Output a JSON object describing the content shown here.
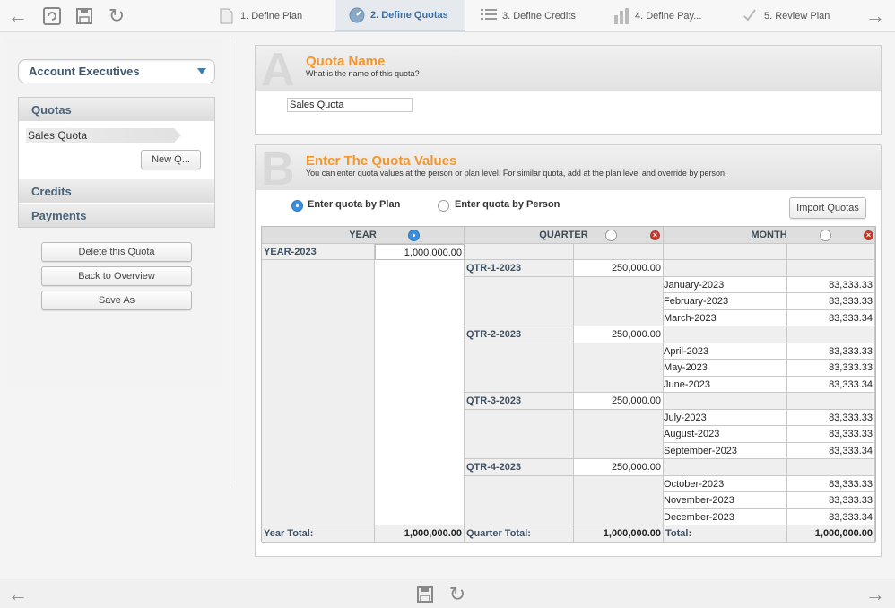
{
  "wizard": {
    "steps": [
      {
        "label": "1. Define Plan",
        "icon": "document-icon"
      },
      {
        "label": "2. Define Quotas",
        "icon": "gauge-icon"
      },
      {
        "label": "3. Define Credits",
        "icon": "list-icon"
      },
      {
        "label": "4. Define Pay...",
        "icon": "bar-chart-icon"
      },
      {
        "label": "5. Review Plan",
        "icon": "check-icon"
      }
    ]
  },
  "sidebar": {
    "role_select": "Account Executives",
    "quotas_label": "Quotas",
    "quota_item": "Sales Quota",
    "new_quota_button": "New Q...",
    "credits_label": "Credits",
    "payments_label": "Payments",
    "delete_button": "Delete this Quota",
    "back_button": "Back to Overview",
    "saveas_button": "Save As"
  },
  "section_a": {
    "letter": "A",
    "title": "Quota Name",
    "subtitle": "What is the name of this quota?",
    "name_value": "Sales Quota"
  },
  "section_b": {
    "letter": "B",
    "title": "Enter The Quota Values",
    "subtitle": "You can enter quota values at the person or plan level. For similar quota, add at the plan level and override by person.",
    "radio_plan": "Enter quota by Plan",
    "radio_person": "Enter quota by Person",
    "import_button": "Import Quotas"
  },
  "table": {
    "headers": {
      "year": "YEAR",
      "quarter": "QUARTER",
      "month": "MONTH"
    },
    "year": {
      "label": "YEAR-2023",
      "value": "1,000,000.00"
    },
    "quarters": [
      {
        "label": "QTR-1-2023",
        "value": "250,000.00",
        "months": [
          {
            "label": "January-2023",
            "value": "83,333.33"
          },
          {
            "label": "February-2023",
            "value": "83,333.33"
          },
          {
            "label": "March-2023",
            "value": "83,333.34"
          }
        ]
      },
      {
        "label": "QTR-2-2023",
        "value": "250,000.00",
        "months": [
          {
            "label": "April-2023",
            "value": "83,333.33"
          },
          {
            "label": "May-2023",
            "value": "83,333.33"
          },
          {
            "label": "June-2023",
            "value": "83,333.34"
          }
        ]
      },
      {
        "label": "QTR-3-2023",
        "value": "250,000.00",
        "months": [
          {
            "label": "July-2023",
            "value": "83,333.33"
          },
          {
            "label": "August-2023",
            "value": "83,333.33"
          },
          {
            "label": "September-2023",
            "value": "83,333.34"
          }
        ]
      },
      {
        "label": "QTR-4-2023",
        "value": "250,000.00",
        "months": [
          {
            "label": "October-2023",
            "value": "83,333.33"
          },
          {
            "label": "November-2023",
            "value": "83,333.33"
          },
          {
            "label": "December-2023",
            "value": "83,333.34"
          }
        ]
      }
    ],
    "totals": {
      "year_label": "Year Total:",
      "year_value": "1,000,000.00",
      "quarter_label": "Quarter Total:",
      "quarter_value": "1,000,000.00",
      "month_label": "Total:",
      "month_value": "1,000,000.00"
    }
  },
  "colors": {
    "accent_orange": "#f4962a",
    "selected_blue": "#3b8fe0",
    "delete_red": "#c0392b"
  }
}
